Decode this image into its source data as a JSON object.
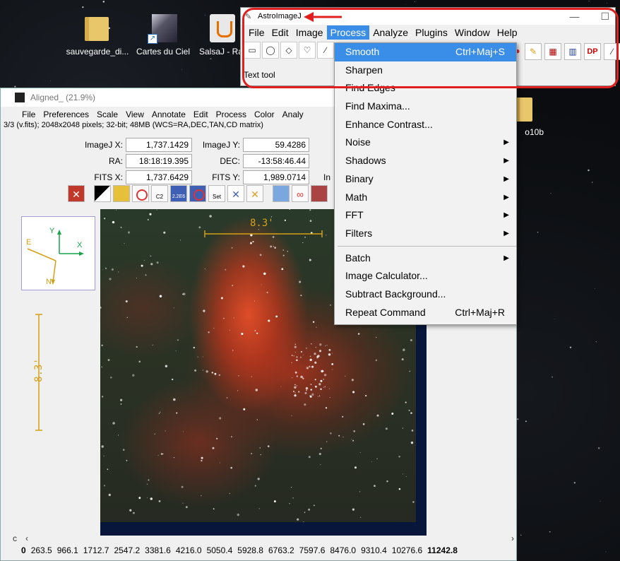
{
  "desktop": {
    "icons": [
      {
        "label": "sauvegarde_di...",
        "type": "folder"
      },
      {
        "label": "Cartes du Ciel",
        "type": "comet"
      },
      {
        "label": "SalsaJ - Ra",
        "type": "java"
      },
      {
        "label": "o10b",
        "type": "folder"
      }
    ]
  },
  "image_window": {
    "title": "Aligned_ (21.9%)",
    "menu": [
      "File",
      "Preferences",
      "Scale",
      "View",
      "Annotate",
      "Edit",
      "Process",
      "Color",
      "Analy"
    ],
    "info": "3/3 (v.fits); 2048x2048 pixels; 32-bit; 48MB (WCS=RA,DEC,TAN,CD matrix)",
    "coords": {
      "imagej_x_label": "ImageJ X:",
      "imagej_x": "1,737.1429",
      "imagej_y_label": "ImageJ Y:",
      "imagej_y": "59.4286",
      "ra_label": "RA:",
      "ra": "18:18:19.395",
      "dec_label": "DEC:",
      "dec": "-13:58:46.44",
      "fits_x_label": "FITS X:",
      "fits_x": "1,737.6429",
      "fits_y_label": "FITS Y:",
      "fits_y": "1,989.0714",
      "in_label": "In"
    },
    "tool_labels": {
      "c2": "C2",
      "size": "2.2E6",
      "set": "Set"
    },
    "scale_label_h": "8.3'",
    "scale_label_v": "8.3'",
    "compass": {
      "y": "Y",
      "x": "X",
      "e": "E",
      "n": "N"
    },
    "scroll_c": "c",
    "histogram_ticks": [
      "0",
      "263.5",
      "966.1",
      "1712.7",
      "2547.2",
      "3381.6",
      "4216.0",
      "5050.4",
      "5928.8",
      "6763.2",
      "7597.6",
      "8476.0",
      "9310.4",
      "10276.6",
      "11242.8"
    ]
  },
  "aij_window": {
    "title": "AstroImageJ",
    "menu": [
      "File",
      "Edit",
      "Image",
      "Process",
      "Analyze",
      "Plugins",
      "Window",
      "Help"
    ],
    "active_menu": "Process",
    "status": "Text tool",
    "dp_label": "DP"
  },
  "process_menu": {
    "items": [
      {
        "label": "Smooth",
        "shortcut": "Ctrl+Maj+S",
        "submenu": false,
        "highlighted": true
      },
      {
        "label": "Sharpen",
        "shortcut": "",
        "submenu": false
      },
      {
        "label": "Find Edges",
        "shortcut": "",
        "submenu": false
      },
      {
        "label": "Find Maxima...",
        "shortcut": "",
        "submenu": false
      },
      {
        "label": "Enhance Contrast...",
        "shortcut": "",
        "submenu": false
      },
      {
        "label": "Noise",
        "shortcut": "",
        "submenu": true
      },
      {
        "label": "Shadows",
        "shortcut": "",
        "submenu": true
      },
      {
        "label": "Binary",
        "shortcut": "",
        "submenu": true
      },
      {
        "label": "Math",
        "shortcut": "",
        "submenu": true
      },
      {
        "label": "FFT",
        "shortcut": "",
        "submenu": true
      },
      {
        "label": "Filters",
        "shortcut": "",
        "submenu": true
      },
      {
        "label": "Batch",
        "shortcut": "",
        "submenu": true
      },
      {
        "label": "Image Calculator...",
        "shortcut": "",
        "submenu": false
      },
      {
        "label": "Subtract Background...",
        "shortcut": "",
        "submenu": false
      },
      {
        "label": "Repeat Command",
        "shortcut": "Ctrl+Maj+R",
        "submenu": false
      }
    ]
  },
  "colors": {
    "highlight": "#3b8ee8",
    "annotation_red": "#e02020",
    "scale_gold": "#d4a017"
  }
}
